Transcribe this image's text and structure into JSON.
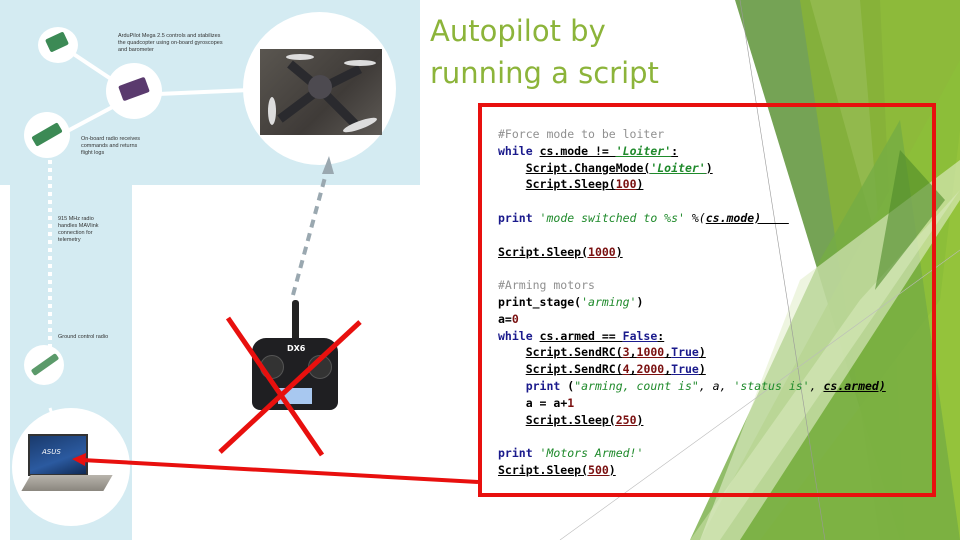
{
  "slide": {
    "title_line1": "Autopilot by",
    "title_line2": "running a script",
    "accent_color": "#8cb43a",
    "highlight_color": "#e8100e"
  },
  "infographic": {
    "captions": {
      "apm": "ArduPilot Mega 2.5 controls and stabilizes the quadcopter using on-board gyroscopes and barometer",
      "onboard_radio": "On-board radio receives commands and returns flight logs",
      "radio_915": "915 MHz radio handles MAVlink connection for telemetry",
      "ground_radio": "Ground control radio"
    },
    "images": [
      "gps-module",
      "apm-board",
      "onboard-radio",
      "quadcopter-photo",
      "usb-radio-dongle",
      "laptop",
      "rc-transmitter"
    ],
    "transmitter_label": "DX6",
    "laptop_brand": "ASUS"
  },
  "code": {
    "lines": [
      {
        "type": "comment",
        "text": "#Force mode to be loiter"
      },
      {
        "type": "while1",
        "kw": "while",
        "cond": "cs.mode != ",
        "str": "'Loiter'",
        "end": ":"
      },
      {
        "type": "call",
        "indent": "    ",
        "pre": "Script.ChangeMode(",
        "str": "'Loiter'",
        "post": ")"
      },
      {
        "type": "sleep",
        "indent": "    ",
        "pre": "Script.Sleep(",
        "num": "100",
        "post": ")"
      },
      {
        "type": "blank"
      },
      {
        "type": "print1",
        "kw": "print",
        "str": " 'mode switched to %s'",
        "rest": " %(",
        "u": "cs.mode)    "
      },
      {
        "type": "blank"
      },
      {
        "type": "sleep",
        "indent": "",
        "pre": "Script.Sleep(",
        "num": "1000",
        "post": ")"
      },
      {
        "type": "blank"
      },
      {
        "type": "comment",
        "text": "#Arming motors"
      },
      {
        "type": "stage",
        "pre": "print_stage(",
        "str": "'arming'",
        "post": ")"
      },
      {
        "type": "assign",
        "pre": "a=",
        "num": "0"
      },
      {
        "type": "while2",
        "kw": "while",
        "cond": "cs.armed == ",
        "kw2": "False",
        "end": ":"
      },
      {
        "type": "sendrc",
        "indent": "    ",
        "pre": "Script.SendRC(",
        "n1": "3",
        "sep1": ",",
        "n2": "1000",
        "sep2": ",",
        "kw2": "True",
        "post": ")"
      },
      {
        "type": "sendrc",
        "indent": "    ",
        "pre": "Script.SendRC(",
        "n1": "4",
        "sep1": ",",
        "n2": "2000",
        "sep2": ",",
        "kw2": "True",
        "post": ")"
      },
      {
        "type": "print2",
        "indent": "    ",
        "kw": "print",
        "p1": " (",
        "str1": "\"arming, count is\"",
        "p2": ", a, ",
        "str2": "'status is'",
        "p3": ", ",
        "u": "cs.armed)"
      },
      {
        "type": "incr",
        "indent": "    ",
        "pre": "a = a+",
        "num": "1"
      },
      {
        "type": "sleep",
        "indent": "    ",
        "pre": "Script.Sleep(",
        "num": "250",
        "post": ")"
      },
      {
        "type": "blank"
      },
      {
        "type": "print3",
        "kw": "print",
        "str": " 'Motors Armed!'"
      },
      {
        "type": "sleep",
        "indent": "",
        "pre": "Script.Sleep(",
        "num": "500",
        "post": ")"
      }
    ]
  }
}
